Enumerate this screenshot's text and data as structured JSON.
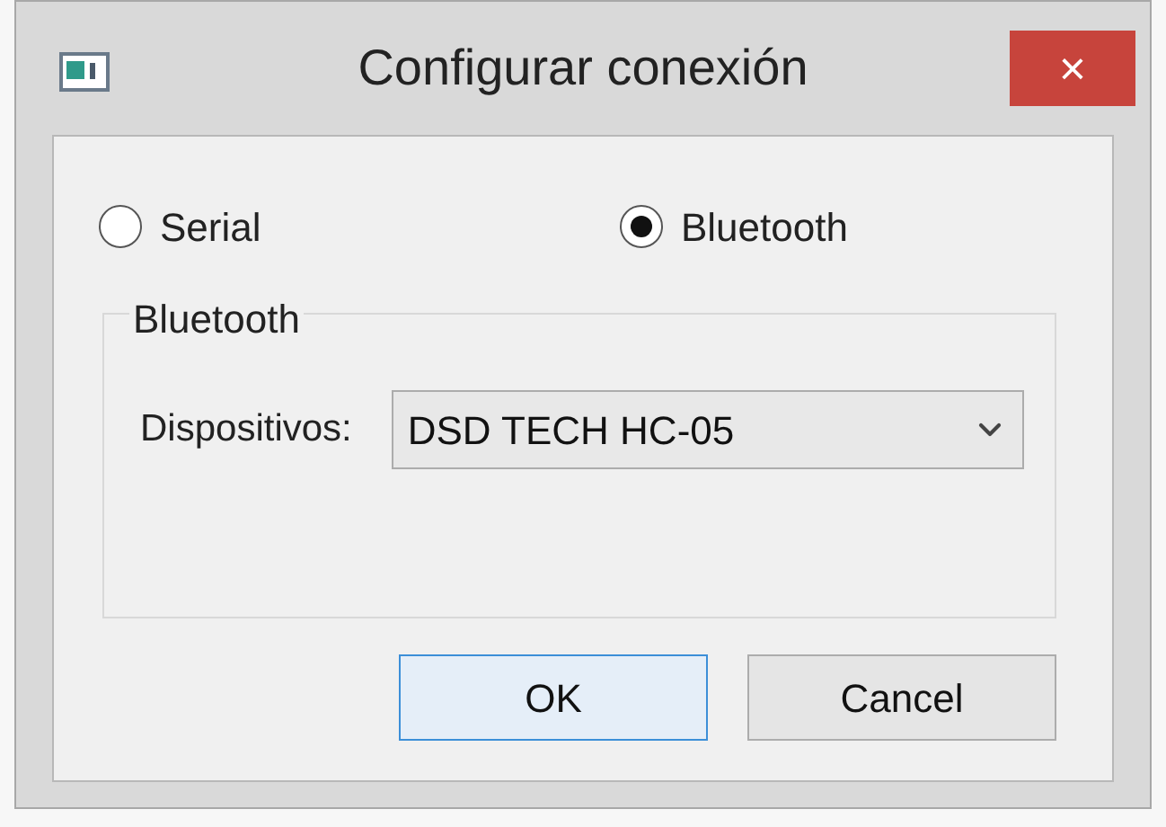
{
  "window": {
    "title": "Configurar conexión",
    "close": "×"
  },
  "connection_types": [
    {
      "label": "Serial",
      "selected": false
    },
    {
      "label": "Bluetooth",
      "selected": true
    }
  ],
  "group": {
    "title": "Bluetooth",
    "label": "Dispositivos:",
    "value": "DSD TECH HC-05"
  },
  "buttons": [
    {
      "label": "OK",
      "default": true
    },
    {
      "label": "Cancel",
      "default": false
    }
  ]
}
